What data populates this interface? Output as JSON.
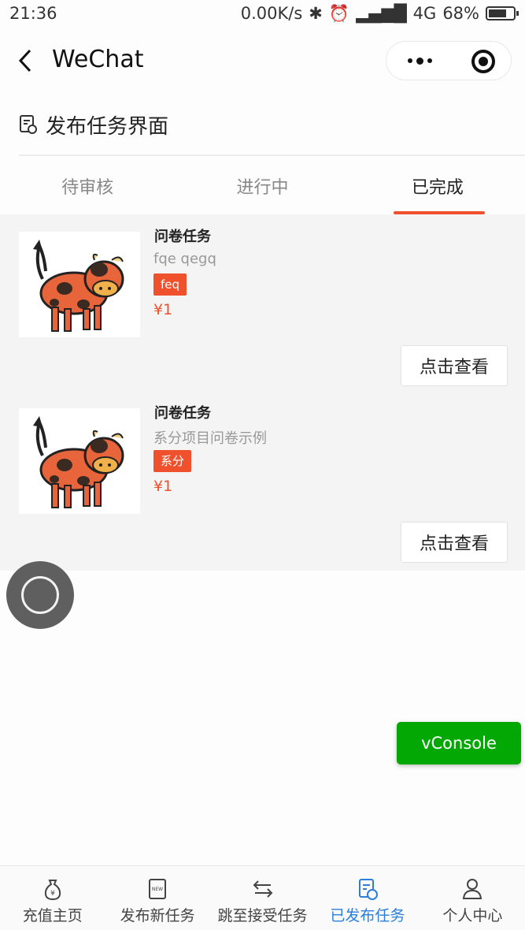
{
  "status_bar": {
    "time": "21:36",
    "network_speed": "0.00K/s",
    "network_type": "4G",
    "battery": "68%"
  },
  "nav": {
    "title": "WeChat",
    "back_icon": "chevron-left-icon",
    "more_icon": "more-dots-icon",
    "close_icon": "target-circle-icon"
  },
  "page_header": {
    "title": "发布任务界面",
    "icon": "document-icon"
  },
  "tabs": [
    {
      "label": "待审核",
      "active": false
    },
    {
      "label": "进行中",
      "active": false
    },
    {
      "label": "已完成",
      "active": true
    }
  ],
  "tasks": [
    {
      "name": "问卷任务",
      "desc": "fqe qegq",
      "tag": "feq",
      "price": "¥1",
      "button": "点击查看"
    },
    {
      "name": "问卷任务",
      "desc": "系分项目问卷示例",
      "tag": "系分",
      "price": "¥1",
      "button": "点击查看"
    }
  ],
  "vconsole": {
    "label": "vConsole",
    "color": "#04a804"
  },
  "tabbar": [
    {
      "label": "充值主页",
      "icon": "money-bag-icon",
      "active": false
    },
    {
      "label": "发布新任务",
      "icon": "new-document-icon",
      "active": false
    },
    {
      "label": "跳至接受任务",
      "icon": "swap-arrows-icon",
      "active": false
    },
    {
      "label": "已发布任务",
      "icon": "published-document-icon",
      "active": true
    },
    {
      "label": "个人中心",
      "icon": "user-icon",
      "active": false
    }
  ],
  "colors": {
    "accent": "#f0512d",
    "tab_active": "#2b7fdb"
  }
}
